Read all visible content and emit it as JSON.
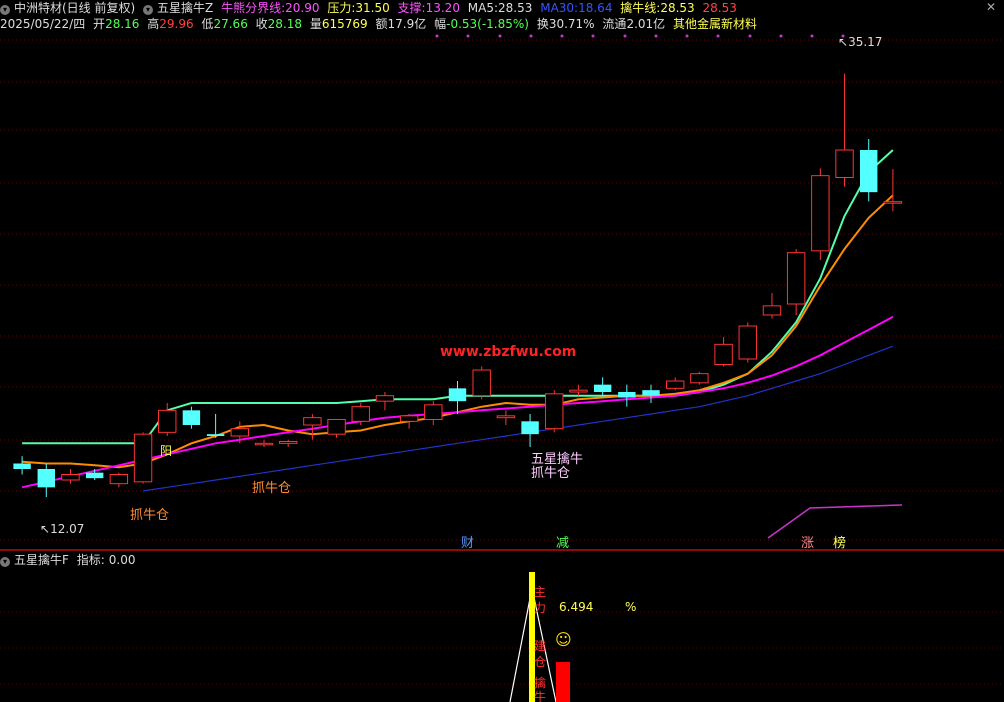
{
  "header": {
    "stock_name": "中洲特材(日线 前复权)",
    "indicator_name": "五星擒牛Z",
    "niu_label": "牛熊分界线:",
    "niu_value": "20.90",
    "pressure_label": "压力:",
    "pressure_value": "31.50",
    "support_label": "支撑:",
    "support_value": "13.20",
    "ma5_label": "MA5:",
    "ma5_value": "28.53",
    "ma30_label": "MA30:",
    "ma30_value": "18.64",
    "qn_label": "擒牛线:",
    "qn_value": "28.53",
    "qn_value2": "28.53",
    "close_glyph": "✕"
  },
  "info": {
    "date": "2025/05/22/四",
    "open_label": "开",
    "open": "28.16",
    "high_label": "高",
    "high": "29.96",
    "low_label": "低",
    "low": "27.66",
    "close_label": "收",
    "close": "28.18",
    "vol_label": "量",
    "vol": "615769",
    "amt_label": "额",
    "amt": "17.9亿",
    "chg_label": "幅",
    "chg": "-0.53(-1.85%)",
    "turn_label": "换",
    "turn": "30.71%",
    "float_label": "流通",
    "float": "2.01亿",
    "sector": "其他金属新材料"
  },
  "annotations": {
    "max_price": "35.17",
    "min_price": "12.07",
    "watermark": "www.zbzfwu.com",
    "yang": "阳",
    "zhuaniu1": "抓牛仓",
    "zhuaniu2": "抓牛仓",
    "zhuaniu3": "抓牛仓",
    "wxqn": "五星擒牛",
    "cai": "财",
    "jian": "减",
    "zhang": "涨",
    "bang": "榜"
  },
  "lower_panel": {
    "title": "五星擒牛F",
    "indicator_label": "指标:",
    "indicator_value": "0.00",
    "pct_value": "6.494",
    "pct_sign": "%",
    "col_text": [
      "主",
      "力",
      "建",
      "仓",
      "擒",
      "牛"
    ],
    "smiley": "☺"
  },
  "chart_data": {
    "type": "candlestick",
    "ylim": [
      10,
      37
    ],
    "candles": [
      {
        "o": 13.9,
        "h": 14.3,
        "l": 13.3,
        "c": 13.6
      },
      {
        "o": 13.6,
        "h": 13.9,
        "l": 12.07,
        "c": 12.6
      },
      {
        "o": 13.0,
        "h": 13.6,
        "l": 12.8,
        "c": 13.3
      },
      {
        "o": 13.4,
        "h": 13.6,
        "l": 13.0,
        "c": 13.1
      },
      {
        "o": 12.8,
        "h": 13.4,
        "l": 12.6,
        "c": 13.3
      },
      {
        "o": 12.9,
        "h": 15.6,
        "l": 12.8,
        "c": 15.5
      },
      {
        "o": 15.6,
        "h": 17.2,
        "l": 15.4,
        "c": 16.8
      },
      {
        "o": 16.8,
        "h": 17.0,
        "l": 15.8,
        "c": 16.0
      },
      {
        "o": 15.5,
        "h": 16.6,
        "l": 15.3,
        "c": 15.4
      },
      {
        "o": 15.4,
        "h": 16.2,
        "l": 15.0,
        "c": 15.8
      },
      {
        "o": 15.0,
        "h": 15.2,
        "l": 14.8,
        "c": 15.0
      },
      {
        "o": 15.0,
        "h": 15.2,
        "l": 14.8,
        "c": 15.1
      },
      {
        "o": 16.0,
        "h": 16.6,
        "l": 15.2,
        "c": 16.4
      },
      {
        "o": 15.5,
        "h": 16.0,
        "l": 15.3,
        "c": 16.3
      },
      {
        "o": 16.2,
        "h": 17.2,
        "l": 16.0,
        "c": 17.0
      },
      {
        "o": 17.3,
        "h": 17.8,
        "l": 16.8,
        "c": 17.6
      },
      {
        "o": 16.2,
        "h": 16.6,
        "l": 15.8,
        "c": 16.5
      },
      {
        "o": 16.3,
        "h": 17.3,
        "l": 16.0,
        "c": 17.1
      },
      {
        "o": 18.0,
        "h": 18.4,
        "l": 16.6,
        "c": 17.3
      },
      {
        "o": 17.6,
        "h": 19.2,
        "l": 17.4,
        "c": 19.0
      },
      {
        "o": 16.4,
        "h": 16.8,
        "l": 16.0,
        "c": 16.5
      },
      {
        "o": 16.2,
        "h": 16.6,
        "l": 14.8,
        "c": 15.5
      },
      {
        "o": 15.8,
        "h": 17.9,
        "l": 15.6,
        "c": 17.7
      },
      {
        "o": 17.8,
        "h": 18.2,
        "l": 17.6,
        "c": 17.9
      },
      {
        "o": 18.2,
        "h": 18.6,
        "l": 17.6,
        "c": 17.8
      },
      {
        "o": 17.8,
        "h": 18.2,
        "l": 17.0,
        "c": 17.5
      },
      {
        "o": 17.9,
        "h": 18.2,
        "l": 17.2,
        "c": 17.6
      },
      {
        "o": 18.0,
        "h": 18.6,
        "l": 17.9,
        "c": 18.4
      },
      {
        "o": 18.3,
        "h": 18.9,
        "l": 18.2,
        "c": 18.8
      },
      {
        "o": 19.3,
        "h": 20.8,
        "l": 19.2,
        "c": 20.4
      },
      {
        "o": 19.6,
        "h": 21.6,
        "l": 19.4,
        "c": 21.4
      },
      {
        "o": 22.0,
        "h": 23.2,
        "l": 21.8,
        "c": 22.5
      },
      {
        "o": 22.6,
        "h": 25.6,
        "l": 22.0,
        "c": 25.4
      },
      {
        "o": 25.5,
        "h": 30.0,
        "l": 25.0,
        "c": 29.6
      },
      {
        "o": 29.5,
        "h": 35.17,
        "l": 29.0,
        "c": 31.0
      },
      {
        "o": 31.0,
        "h": 31.6,
        "l": 28.2,
        "c": 28.7
      },
      {
        "o": 28.16,
        "h": 29.96,
        "l": 27.66,
        "c": 28.18
      }
    ],
    "series": [
      {
        "name": "MA5",
        "color": "#55ffaa",
        "values": [
          15.0,
          15.0,
          15.0,
          15.0,
          15.0,
          15.0,
          16.8,
          17.2,
          17.2,
          17.2,
          17.2,
          17.2,
          17.2,
          17.2,
          17.3,
          17.4,
          17.4,
          17.4,
          17.6,
          17.6,
          17.6,
          17.6,
          17.6,
          17.6,
          17.6,
          17.6,
          17.6,
          17.6,
          17.8,
          18.2,
          18.8,
          20.0,
          21.6,
          24.0,
          27.4,
          29.8,
          31.0
        ]
      },
      {
        "name": "擒牛线",
        "color": "#ff8c00",
        "values": [
          14.0,
          13.9,
          13.9,
          13.8,
          13.7,
          13.9,
          14.4,
          15.0,
          15.4,
          15.9,
          16.0,
          15.7,
          15.5,
          15.6,
          15.7,
          16.0,
          16.2,
          16.4,
          16.7,
          17.0,
          17.2,
          17.1,
          17.1,
          17.4,
          17.5,
          17.6,
          17.6,
          17.7,
          17.9,
          18.3,
          18.8,
          19.8,
          21.4,
          23.6,
          25.6,
          27.3,
          28.53
        ]
      },
      {
        "name": "支撑",
        "color": "#ff00ff",
        "values": [
          12.6,
          12.9,
          13.2,
          13.5,
          13.8,
          14.1,
          14.4,
          14.7,
          15.0,
          15.2,
          15.4,
          15.6,
          15.8,
          16.0,
          16.2,
          16.4,
          16.5,
          16.6,
          16.7,
          16.8,
          16.9,
          17.0,
          17.1,
          17.2,
          17.3,
          17.4,
          17.5,
          17.6,
          17.8,
          18.0,
          18.3,
          18.7,
          19.2,
          19.8,
          20.5,
          21.2,
          21.9
        ]
      },
      {
        "name": "MA30",
        "color": "#2233cc",
        "values": [
          null,
          null,
          null,
          null,
          null,
          12.4,
          12.6,
          12.8,
          13.0,
          13.2,
          13.4,
          13.6,
          13.8,
          14.0,
          14.2,
          14.4,
          14.6,
          14.8,
          15.0,
          15.2,
          15.4,
          15.6,
          15.8,
          16.0,
          16.2,
          16.4,
          16.6,
          16.8,
          17.0,
          17.3,
          17.6,
          18.0,
          18.4,
          18.8,
          19.3,
          19.8,
          20.3
        ]
      }
    ]
  }
}
